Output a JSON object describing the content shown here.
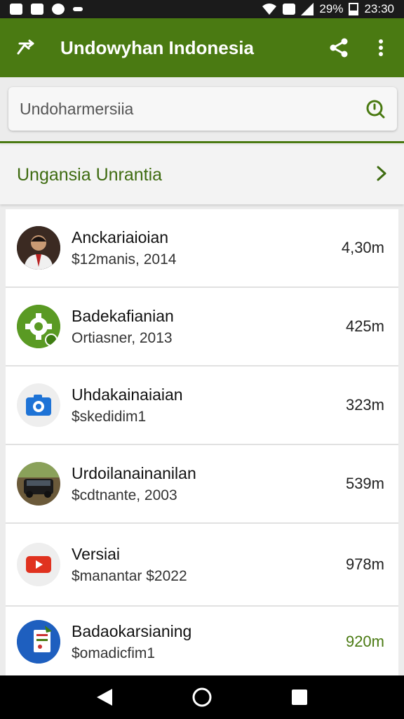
{
  "status_bar": {
    "battery_text": "29%",
    "time": "23:30"
  },
  "app_bar": {
    "title": "Undowyhan Indonesia",
    "icons": [
      "trend-icon",
      "share-icon",
      "more-vert-icon"
    ]
  },
  "search": {
    "value": "Undoharmersiia",
    "icon": "search-icon"
  },
  "section": {
    "label": "Ungansia Unrantia",
    "icon": "chevron-right-icon"
  },
  "list": {
    "items": [
      {
        "title": "Anckariaioian",
        "subtitle": "$12manis, 2014",
        "value": "4,30m",
        "icon": "person-photo"
      },
      {
        "title": "Badekafianian",
        "subtitle": "Ortiasner, 2013",
        "value": "425m",
        "icon": "gear-icon"
      },
      {
        "title": "Uhdakainaiaian",
        "subtitle": "$skedidim1",
        "value": "323m",
        "icon": "camera-icon"
      },
      {
        "title": "Urdoilanainanilan",
        "subtitle": "$cdtnante, 2003",
        "value": "539m",
        "icon": "car-photo"
      },
      {
        "title": "Versiai",
        "subtitle": "$manantar $2022",
        "value": "978m",
        "icon": "play-icon"
      },
      {
        "title": "Badaokarsianing",
        "subtitle": "$omadicfim1",
        "value": "920m",
        "icon": "document-icon"
      }
    ]
  },
  "colors": {
    "primary": "#4a7a12",
    "accent_text": "#3e6b10"
  }
}
